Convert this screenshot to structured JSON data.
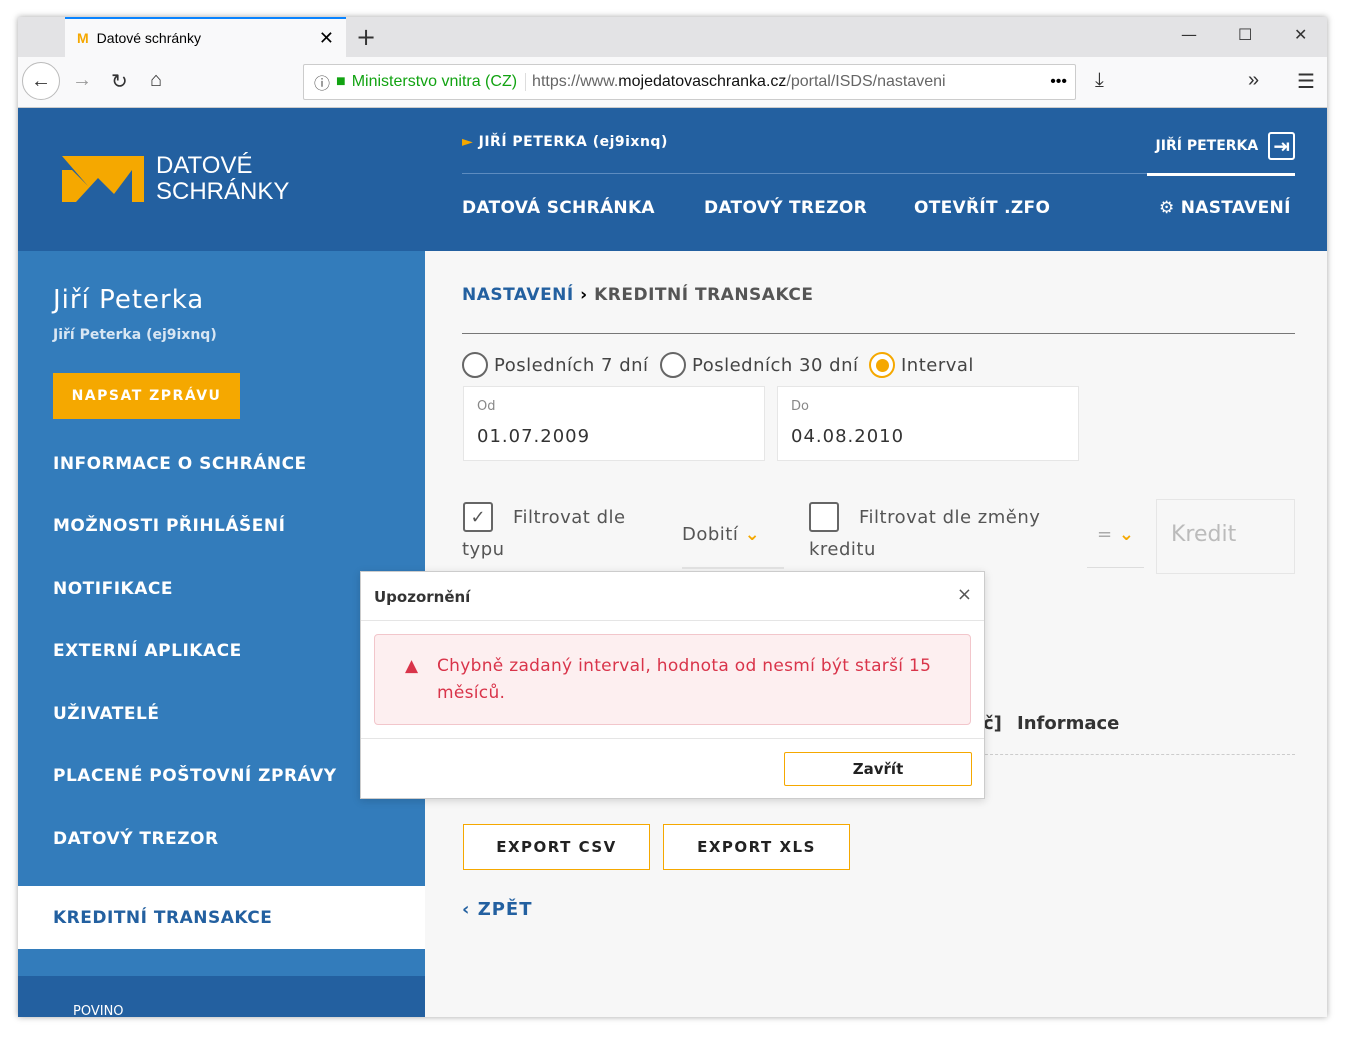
{
  "browser": {
    "tab_title": "Datové schránky",
    "org": "Ministerstvo vnitra (CZ)",
    "url_prefix": "https://www.",
    "url_domain": "mojedatovaschranka.cz",
    "url_path": "/portal/ISDS/nastaveni"
  },
  "header": {
    "logo_line1": "DATOVÉ",
    "logo_line2": "SCHRÁNKY",
    "user_box": "JIŘÍ PETERKA (ej9ixnq)",
    "user": "JIŘÍ PETERKA",
    "nav": [
      "DATOVÁ SCHRÁNKA",
      "DATOVÝ TREZOR",
      "OTEVŘÍT .ZFO",
      "NASTAVENÍ"
    ]
  },
  "sidebar": {
    "name": "Jiří Peterka",
    "sub": "Jiří Peterka (ej9ixnq)",
    "write": "NAPSAT ZPRÁVU",
    "items": [
      "INFORMACE O SCHRÁNCE",
      "MOŽNOSTI PŘIHLÁŠENÍ",
      "NOTIFIKACE",
      "EXTERNÍ APLIKACE",
      "UŽIVATELÉ",
      "PLACENÉ POŠTOVNÍ ZPRÁVY",
      "DATOVÝ TREZOR",
      "KREDITNÍ TRANSAKCE"
    ],
    "footer": "POVINO"
  },
  "main": {
    "bc1": "NASTAVENÍ",
    "bc2": "KREDITNÍ TRANSAKCE",
    "radios": [
      "Posledních 7 dní",
      "Posledních 30 dní",
      "Interval"
    ],
    "from_label": "Od",
    "from": "01.07.2009",
    "to_label": "Do",
    "to": "04.08.2010",
    "filter_type_1": "Filtrovat dle",
    "filter_type_2": "typu",
    "type_value": "Dobití",
    "filter_change_1": "Filtrovat dle změny",
    "filter_change_2": "kreditu",
    "op": "=",
    "kredit_placeholder": "Kredit",
    "col_partial": "č]",
    "col_info": "Informace",
    "export_csv": "EXPORT CSV",
    "export_xls": "EXPORT XLS",
    "back": "ZPĚT"
  },
  "modal": {
    "title": "Upozornění",
    "message": "Chybně zadaný interval, hodnota od nesmí být starší 15 měsíců.",
    "close": "Zavřít"
  }
}
